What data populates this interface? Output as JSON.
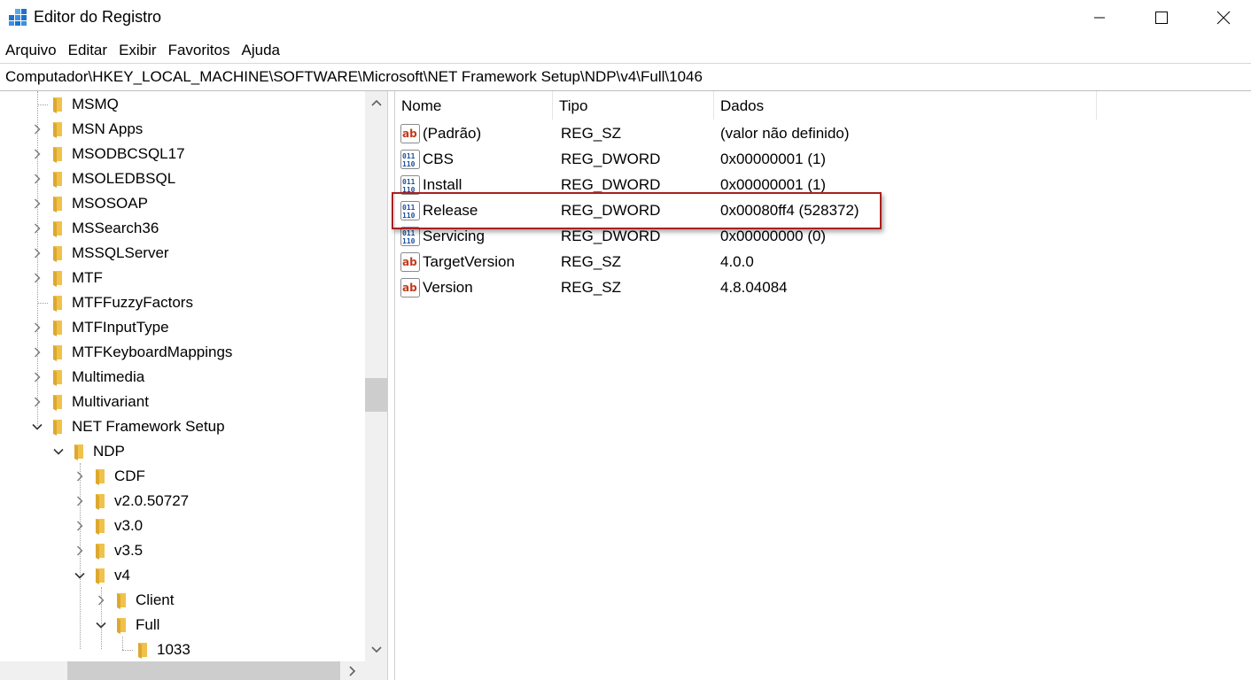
{
  "window": {
    "title": "Editor do Registro",
    "app_icon": "registry-editor-icon",
    "controls": [
      "minimize-icon",
      "maximize-icon",
      "close-icon"
    ]
  },
  "menu": [
    "Arquivo",
    "Editar",
    "Exibir",
    "Favoritos",
    "Ajuda"
  ],
  "address": "Computador\\HKEY_LOCAL_MACHINE\\SOFTWARE\\Microsoft\\NET Framework Setup\\NDP\\v4\\Full\\1046",
  "tree": {
    "items": [
      {
        "label": "MSMQ",
        "state": "leaf"
      },
      {
        "label": "MSN Apps",
        "state": "collapsed"
      },
      {
        "label": "MSODBCSQL17",
        "state": "collapsed"
      },
      {
        "label": "MSOLEDBSQL",
        "state": "collapsed"
      },
      {
        "label": "MSOSOAP",
        "state": "collapsed"
      },
      {
        "label": "MSSearch36",
        "state": "collapsed"
      },
      {
        "label": "MSSQLServer",
        "state": "collapsed"
      },
      {
        "label": "MTF",
        "state": "collapsed"
      },
      {
        "label": "MTFFuzzyFactors",
        "state": "leaf"
      },
      {
        "label": "MTFInputType",
        "state": "collapsed"
      },
      {
        "label": "MTFKeyboardMappings",
        "state": "collapsed"
      },
      {
        "label": "Multimedia",
        "state": "collapsed"
      },
      {
        "label": "Multivariant",
        "state": "collapsed"
      },
      {
        "label": "NET Framework Setup",
        "state": "expanded"
      },
      {
        "label": "NDP",
        "state": "expanded"
      },
      {
        "label": "CDF",
        "state": "collapsed"
      },
      {
        "label": "v2.0.50727",
        "state": "collapsed"
      },
      {
        "label": "v3.0",
        "state": "collapsed"
      },
      {
        "label": "v3.5",
        "state": "collapsed"
      },
      {
        "label": "v4",
        "state": "expanded"
      },
      {
        "label": "Client",
        "state": "collapsed"
      },
      {
        "label": "Full",
        "state": "expanded"
      },
      {
        "label": "1033",
        "state": "leaf"
      }
    ]
  },
  "list": {
    "columns": [
      "Nome",
      "Tipo",
      "Dados"
    ],
    "rows": [
      {
        "name": "(Padrão)",
        "type": "REG_SZ",
        "data": "(valor não definido)",
        "icon": "string-value-icon"
      },
      {
        "name": "CBS",
        "type": "REG_DWORD",
        "data": "0x00000001 (1)",
        "icon": "binary-value-icon"
      },
      {
        "name": "Install",
        "type": "REG_DWORD",
        "data": "0x00000001 (1)",
        "icon": "binary-value-icon"
      },
      {
        "name": "Release",
        "type": "REG_DWORD",
        "data": "0x00080ff4 (528372)",
        "icon": "binary-value-icon"
      },
      {
        "name": "Servicing",
        "type": "REG_DWORD",
        "data": "0x00000000 (0)",
        "icon": "binary-value-icon"
      },
      {
        "name": "TargetVersion",
        "type": "REG_SZ",
        "data": "4.0.0",
        "icon": "string-value-icon"
      },
      {
        "name": "Version",
        "type": "REG_SZ",
        "data": "4.8.04084",
        "icon": "string-value-icon"
      }
    ],
    "highlighted_row": "Release"
  },
  "colors": {
    "highlight_border": "#a9201f",
    "folder": "#f0c24a"
  }
}
